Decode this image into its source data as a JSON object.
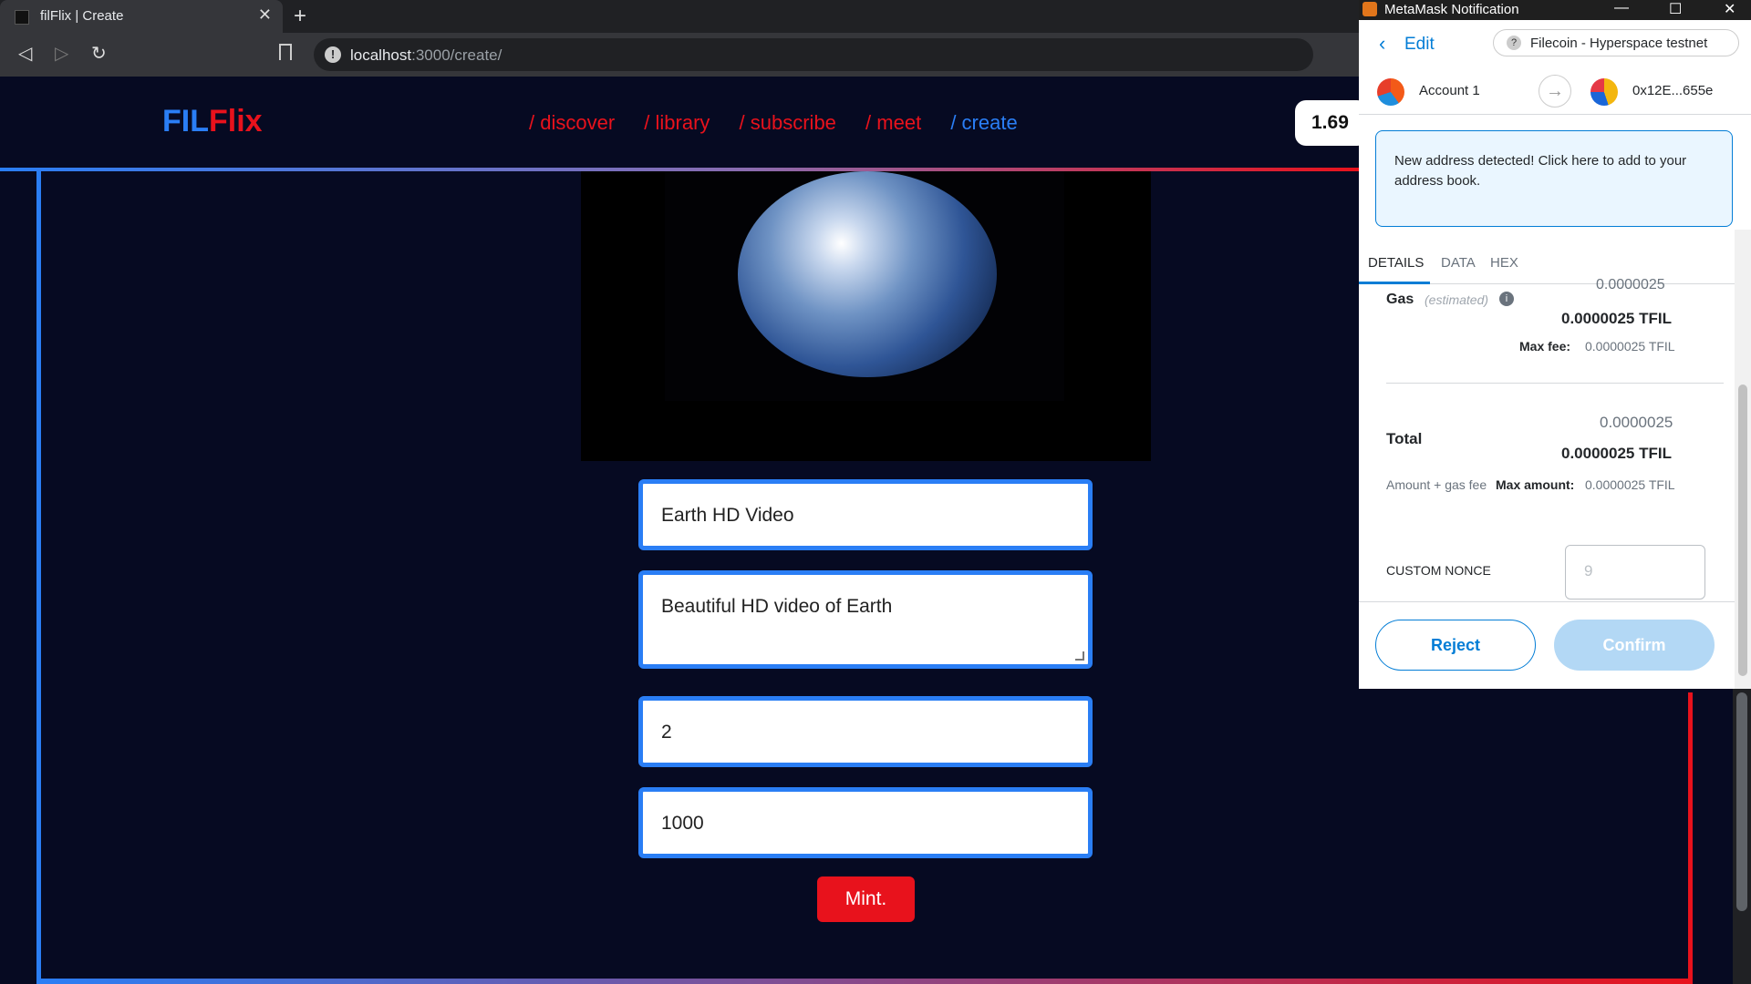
{
  "browser": {
    "tab_title": "filFlix | Create",
    "url_host": "localhost",
    "url_path": ":3000/create/"
  },
  "site": {
    "logo_fil": "FIL",
    "logo_flix": "Flix",
    "nav": [
      "/ discover",
      "/ library",
      "/ subscribe",
      "/ meet",
      "/ create"
    ],
    "price_badge": "1.69",
    "form": {
      "title": "Earth HD Video",
      "description": "Beautiful HD video of Earth",
      "price": "2",
      "supply": "1000",
      "mint_label": "Mint."
    },
    "colors": {
      "accent_blue": "#2a7ef5",
      "accent_red": "#e8121c",
      "background": "#060a22"
    }
  },
  "metamask": {
    "window_title": "MetaMask Notification",
    "edit_label": "Edit",
    "network": "Filecoin - Hyperspace testnet",
    "from_account": "Account 1",
    "to_address": "0x12E...655e",
    "alert": "New address detected! Click here to add to your address book.",
    "tabs": [
      "DETAILS",
      "DATA",
      "HEX"
    ],
    "gas_cutoff_top": "0.0000025",
    "gas_label": "Gas",
    "gas_estimated": "(estimated)",
    "gas_value": "0.0000025 TFIL",
    "max_fee_label": "Max fee:",
    "max_fee_value": "0.0000025 TFIL",
    "total_small": "0.0000025",
    "total_label": "Total",
    "total_value": "0.0000025 TFIL",
    "amount_gas_label": "Amount + gas fee",
    "max_amount_label": "Max amount:",
    "max_amount_value": "0.0000025 TFIL",
    "custom_nonce_label": "CUSTOM NONCE",
    "nonce_placeholder": "9",
    "reject_label": "Reject",
    "confirm_label": "Confirm"
  }
}
